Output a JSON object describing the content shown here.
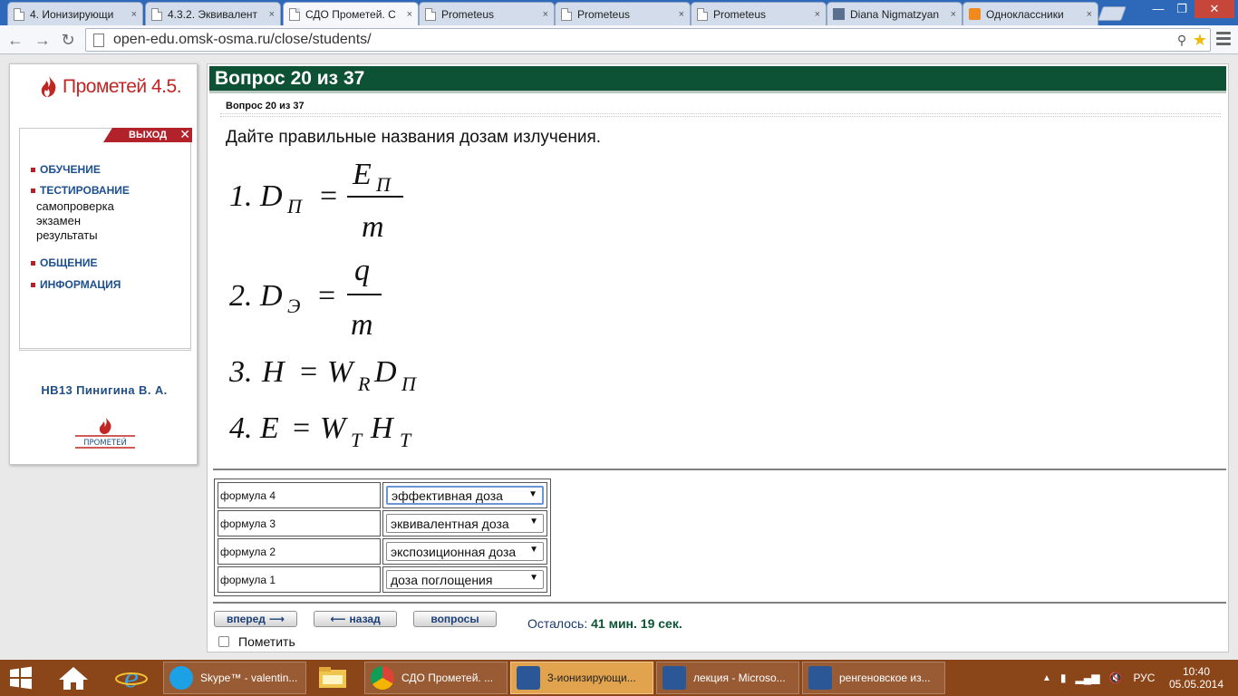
{
  "browser": {
    "tabs": [
      {
        "label": "4. Ионизирующи"
      },
      {
        "label": "4.3.2. Эквивалент"
      },
      {
        "label": "СДО Прометей. С"
      },
      {
        "label": "Prometeus"
      },
      {
        "label": "Prometeus"
      },
      {
        "label": "Prometeus"
      },
      {
        "label": "Diana Nigmatzyan"
      },
      {
        "label": "Одноклассники"
      }
    ],
    "tab_close": "×",
    "url": "open-edu.omsk-osma.ru/close/students/"
  },
  "sidebar": {
    "logo_text": "Прометей 4.5.",
    "exit_label": "ВЫХОД",
    "exit_x": "✕",
    "menu": {
      "training": "ОБУЧЕНИЕ",
      "testing": "ТЕСТИРОВАНИЕ",
      "self_check": "самопроверка",
      "exam": "экзамен",
      "results": "результаты",
      "communication": "ОБЩЕНИЕ",
      "info": "ИНФОРМАЦИЯ"
    },
    "user": "НВ13 Пинигина В. А.",
    "small_logo_text": "ПРОМЕТЕЙ"
  },
  "question": {
    "header": "Вопрос 20 из 37",
    "subheader": "Вопрос 20 из 37",
    "text": "Дайте правильные названия дозам излучения.",
    "formulas": {
      "f1_num": "1.",
      "f1_lhs": "D",
      "f1_lhs_sub": "П",
      "f1_eq": "=",
      "f1_top": "E",
      "f1_top_sub": "П",
      "f1_bottom": "m",
      "f2_num": "2.",
      "f2_lhs": "D",
      "f2_lhs_sub": "Э",
      "f2_eq": "=",
      "f2_top": "q",
      "f2_bottom": "m",
      "f3_num": "3.",
      "f3_lhs": "H",
      "f3_eq": "=",
      "f3_r1": "W",
      "f3_r1_sub": "R",
      "f3_r2": "D",
      "f3_r2_sub": "П",
      "f4_num": "4.",
      "f4_lhs": "E",
      "f4_eq": "=",
      "f4_r1": "W",
      "f4_r1_sub": "T",
      "f4_r2": "H",
      "f4_r2_sub": "T"
    },
    "answers": [
      {
        "label": "формула 4",
        "selected": "эффективная доза"
      },
      {
        "label": "формула 3",
        "selected": "эквивалентная доза"
      },
      {
        "label": "формула 2",
        "selected": "экспозиционная доза"
      },
      {
        "label": "формула 1",
        "selected": "доза поглощения"
      }
    ],
    "select_arrow": "▼"
  },
  "controls": {
    "forward": "вперед",
    "back": "назад",
    "questions": "вопросы",
    "remaining_label": "Осталось:",
    "remaining_value": "41 мин. 19 сек.",
    "mark_label": "Пометить"
  },
  "taskbar": {
    "items": [
      {
        "label": "Skype™ - valentin..."
      },
      {
        "label": "СДО Прометей. ..."
      },
      {
        "label": "3-ионизирующи..."
      },
      {
        "label": "лекция - Microso..."
      },
      {
        "label": "ренгеновское из..."
      }
    ],
    "lang": "РУС",
    "time": "10:40",
    "date": "05.05.2014"
  },
  "colors": {
    "header_green": "#0e5236",
    "brand_red": "#b1222b",
    "link_blue": "#1d4f8f",
    "taskbar": "#8a4519"
  }
}
